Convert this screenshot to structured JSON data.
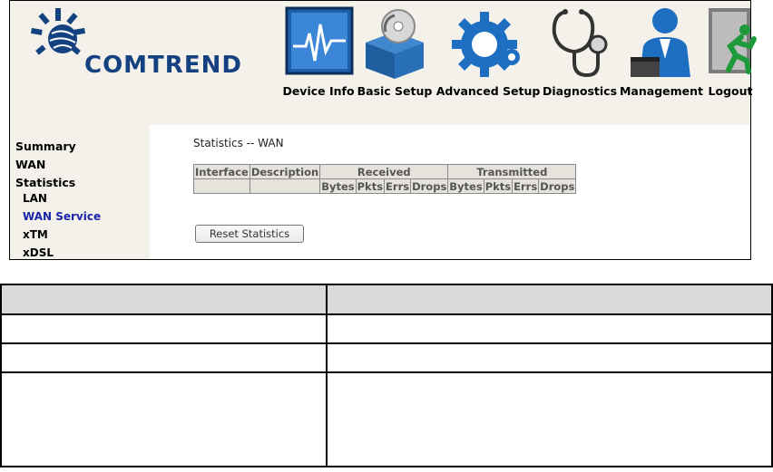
{
  "brand": {
    "name": "COMTREND",
    "color": "#14417f"
  },
  "nav": [
    {
      "label": "Device Info",
      "icon": "device-info-icon"
    },
    {
      "label": "Basic Setup",
      "icon": "basic-setup-icon"
    },
    {
      "label": "Advanced Setup",
      "icon": "advanced-setup-icon"
    },
    {
      "label": "Diagnostics",
      "icon": "diagnostics-icon"
    },
    {
      "label": "Management",
      "icon": "management-icon"
    },
    {
      "label": "Logout",
      "icon": "logout-icon"
    }
  ],
  "sidebar": {
    "items": [
      {
        "label": "Summary"
      },
      {
        "label": "WAN"
      },
      {
        "label": "Statistics"
      },
      {
        "label": "LAN"
      },
      {
        "label": "WAN Service",
        "active": true
      },
      {
        "label": "xTM"
      },
      {
        "label": "xDSL"
      }
    ],
    "active_color": "#1a26a8"
  },
  "main": {
    "title": "Statistics -- WAN",
    "table": {
      "header1": [
        "Interface",
        "Description",
        "Received",
        "Transmitted"
      ],
      "header2": [
        "Bytes",
        "Pkts",
        "Errs",
        "Drops",
        "Bytes",
        "Pkts",
        "Errs",
        "Drops"
      ]
    },
    "reset_button": "Reset Statistics"
  },
  "colors": {
    "header_bg": "#f4f1ea",
    "table_header_bg": "#d9d9d9"
  }
}
